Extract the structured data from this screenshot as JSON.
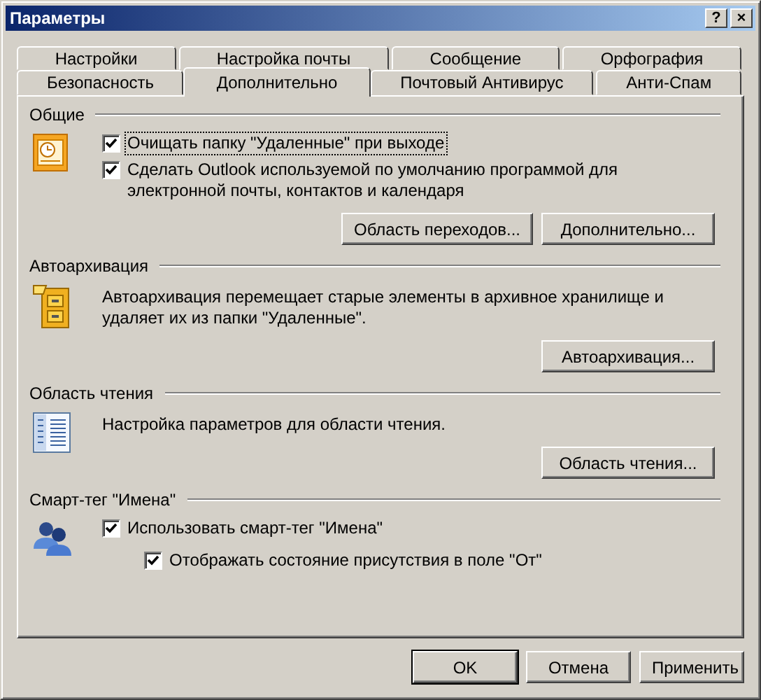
{
  "window": {
    "title": "Параметры",
    "title_buttons": [
      "?",
      "×"
    ]
  },
  "tab_rows": [
    [
      {
        "label": "Настройки",
        "selected": false
      },
      {
        "label": "Настройка почты",
        "selected": false
      },
      {
        "label": "Сообщение",
        "selected": false
      },
      {
        "label": "Орфография",
        "selected": false
      }
    ],
    [
      {
        "label": "Безопасность",
        "selected": false
      },
      {
        "label": "Дополнительно",
        "selected": true
      },
      {
        "label": "Почтовый Антивирус",
        "selected": false
      },
      {
        "label": "Анти-Спам",
        "selected": false
      }
    ]
  ],
  "sections": [
    {
      "kind": "general",
      "title": "Общие",
      "checkboxes": [
        {
          "label": "Очищать папку \"Удаленные\" при выходе",
          "checked": true
        },
        {
          "label": "Сделать Outlook используемой по умолчанию программой для электронной почты, контактов и календаря",
          "checked": true
        }
      ],
      "buttons": [
        "Область переходов...",
        "Дополнительно..."
      ]
    },
    {
      "kind": "autoarchive",
      "title": "Автоархивация",
      "text": "Автоархивация перемещает старые элементы в архивное хранилище и удаляет их из папки \"Удаленные\".",
      "buttons": [
        "Автоархивация..."
      ]
    },
    {
      "kind": "reading",
      "title": "Область чтения",
      "text": "Настройка параметров для области чтения.",
      "buttons": [
        "Область чтения..."
      ]
    },
    {
      "kind": "smarttag",
      "title": "Смарт-тег \"Имена\"",
      "checkboxes": [
        {
          "label": "Использовать смарт-тег \"Имена\"",
          "checked": true,
          "children": [
            {
              "label": "Отображать состояние присутствия в поле \"От\"",
              "checked": true
            }
          ]
        }
      ]
    }
  ],
  "dialog_buttons": [
    {
      "label": "OK",
      "default": true
    },
    {
      "label": "Отмена",
      "default": false
    },
    {
      "label": "Применить",
      "default": false
    }
  ]
}
